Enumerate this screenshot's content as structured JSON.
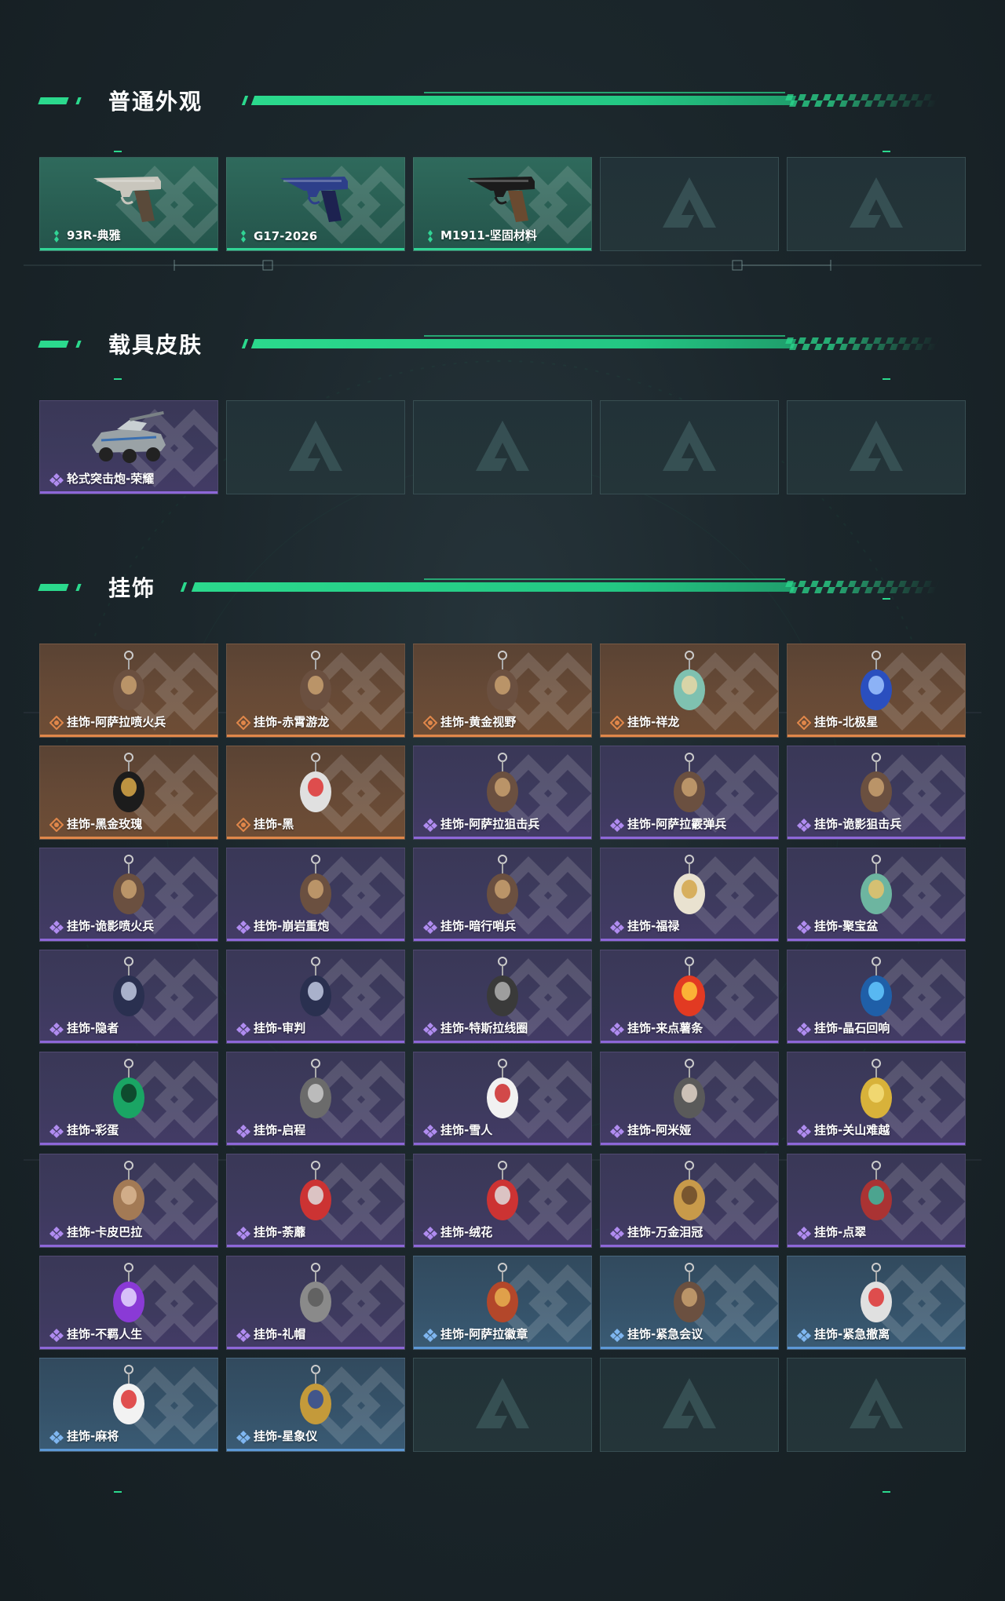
{
  "sections": [
    {
      "title": "普通外观",
      "items": [
        {
          "label": "93R-典雅",
          "rarity": "green",
          "icon": "pistol-silver"
        },
        {
          "label": "G17-2026",
          "rarity": "green",
          "icon": "pistol-blue"
        },
        {
          "label": "M1911-坚固材料",
          "rarity": "green",
          "icon": "pistol-black"
        },
        {
          "label": "",
          "rarity": "empty",
          "icon": "placeholder-logo"
        },
        {
          "label": "",
          "rarity": "empty",
          "icon": "placeholder-logo"
        }
      ]
    },
    {
      "title": "载具皮肤",
      "items": [
        {
          "label": "轮式突击炮-荣耀",
          "rarity": "purple",
          "icon": "armored-vehicle"
        },
        {
          "label": "",
          "rarity": "empty",
          "icon": "placeholder-logo"
        },
        {
          "label": "",
          "rarity": "empty",
          "icon": "placeholder-logo"
        },
        {
          "label": "",
          "rarity": "empty",
          "icon": "placeholder-logo"
        },
        {
          "label": "",
          "rarity": "empty",
          "icon": "placeholder-logo"
        }
      ]
    },
    {
      "title": "挂饰",
      "items": [
        {
          "label": "挂饰-阿萨拉喷火兵",
          "rarity": "orange",
          "icon": "charm-figure"
        },
        {
          "label": "挂饰-赤霄游龙",
          "rarity": "orange",
          "icon": "charm-figure"
        },
        {
          "label": "挂饰-黄金视野",
          "rarity": "orange",
          "icon": "charm-figure"
        },
        {
          "label": "挂饰-祥龙",
          "rarity": "orange",
          "icon": "charm-dragon"
        },
        {
          "label": "挂饰-北极星",
          "rarity": "orange",
          "icon": "charm-star"
        },
        {
          "label": "挂饰-黑金玫瑰",
          "rarity": "orange",
          "icon": "charm-rose"
        },
        {
          "label": "挂饰-黑",
          "rarity": "orange",
          "icon": "charm-tag"
        },
        {
          "label": "挂饰-阿萨拉狙击兵",
          "rarity": "purple",
          "icon": "charm-figure"
        },
        {
          "label": "挂饰-阿萨拉霰弹兵",
          "rarity": "purple",
          "icon": "charm-figure"
        },
        {
          "label": "挂饰-诡影狙击兵",
          "rarity": "purple",
          "icon": "charm-figure"
        },
        {
          "label": "挂饰-诡影喷火兵",
          "rarity": "purple",
          "icon": "charm-figure"
        },
        {
          "label": "挂饰-崩岩重炮",
          "rarity": "purple",
          "icon": "charm-figure"
        },
        {
          "label": "挂饰-暗行哨兵",
          "rarity": "purple",
          "icon": "charm-figure"
        },
        {
          "label": "挂饰-福禄",
          "rarity": "purple",
          "icon": "charm-gourd"
        },
        {
          "label": "挂饰-聚宝盆",
          "rarity": "purple",
          "icon": "charm-bowl"
        },
        {
          "label": "挂饰-隐者",
          "rarity": "purple",
          "icon": "charm-card"
        },
        {
          "label": "挂饰-审判",
          "rarity": "purple",
          "icon": "charm-card"
        },
        {
          "label": "挂饰-特斯拉线圈",
          "rarity": "purple",
          "icon": "charm-coil"
        },
        {
          "label": "挂饰-来点薯条",
          "rarity": "purple",
          "icon": "charm-fries"
        },
        {
          "label": "挂饰-晶石回响",
          "rarity": "purple",
          "icon": "charm-crystal"
        },
        {
          "label": "挂饰-彩蛋",
          "rarity": "purple",
          "icon": "charm-egg"
        },
        {
          "label": "挂饰-启程",
          "rarity": "purple",
          "icon": "charm-medal"
        },
        {
          "label": "挂饰-雪人",
          "rarity": "purple",
          "icon": "charm-snowman"
        },
        {
          "label": "挂饰-阿米娅",
          "rarity": "purple",
          "icon": "charm-bunny"
        },
        {
          "label": "挂饰-关山难越",
          "rarity": "purple",
          "icon": "charm-gold-bar"
        },
        {
          "label": "挂饰-卡皮巴拉",
          "rarity": "purple",
          "icon": "charm-capybara"
        },
        {
          "label": "挂饰-荼蘼",
          "rarity": "purple",
          "icon": "charm-flower"
        },
        {
          "label": "挂饰-绒花",
          "rarity": "purple",
          "icon": "charm-flower"
        },
        {
          "label": "挂饰-万金泪冠",
          "rarity": "purple",
          "icon": "charm-burger"
        },
        {
          "label": "挂饰-点翠",
          "rarity": "purple",
          "icon": "charm-jewel"
        },
        {
          "label": "挂饰-不羁人生",
          "rarity": "purple",
          "icon": "charm-shoe"
        },
        {
          "label": "挂饰-礼帽",
          "rarity": "purple",
          "icon": "charm-hat"
        },
        {
          "label": "挂饰-阿萨拉徽章",
          "rarity": "blue",
          "icon": "charm-badge"
        },
        {
          "label": "挂饰-紧急会议",
          "rarity": "blue",
          "icon": "charm-figure"
        },
        {
          "label": "挂饰-紧急撤离",
          "rarity": "blue",
          "icon": "charm-tag"
        },
        {
          "label": "挂饰-麻将",
          "rarity": "blue",
          "icon": "charm-mahjong"
        },
        {
          "label": "挂饰-星象仪",
          "rarity": "blue",
          "icon": "charm-astrolabe"
        },
        {
          "label": "",
          "rarity": "empty",
          "icon": "placeholder-logo"
        },
        {
          "label": "",
          "rarity": "empty",
          "icon": "placeholder-logo"
        },
        {
          "label": "",
          "rarity": "empty",
          "icon": "placeholder-logo"
        }
      ]
    }
  ],
  "colors": {
    "accent": "#2bd98d",
    "green": "#31d495",
    "orange": "#e0874a",
    "purple": "#8d67d8",
    "blue": "#5c98d6",
    "background": "#1b262b"
  }
}
